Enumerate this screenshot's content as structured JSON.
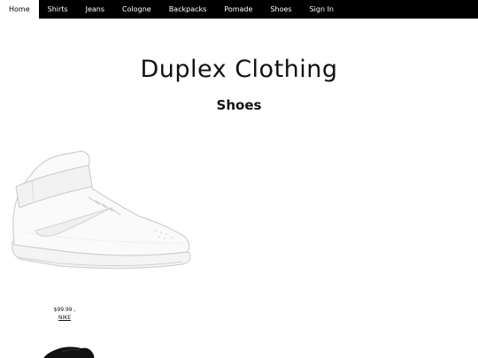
{
  "nav": {
    "items": [
      {
        "label": "Home",
        "active": true
      },
      {
        "label": "Shirts"
      },
      {
        "label": "Jeans"
      },
      {
        "label": "Cologne"
      },
      {
        "label": "Backpacks"
      },
      {
        "label": "Pomade"
      },
      {
        "label": "Shoes"
      },
      {
        "label": "Sign In"
      }
    ]
  },
  "header": {
    "site_title": "Duplex Clothing",
    "section_title": "Shoes"
  },
  "products": [
    {
      "image_icon": "white-high-top-sneaker",
      "price": "$99.99 ,",
      "brand": "NIKE"
    },
    {
      "image_icon": "black-sneaker"
    }
  ]
}
